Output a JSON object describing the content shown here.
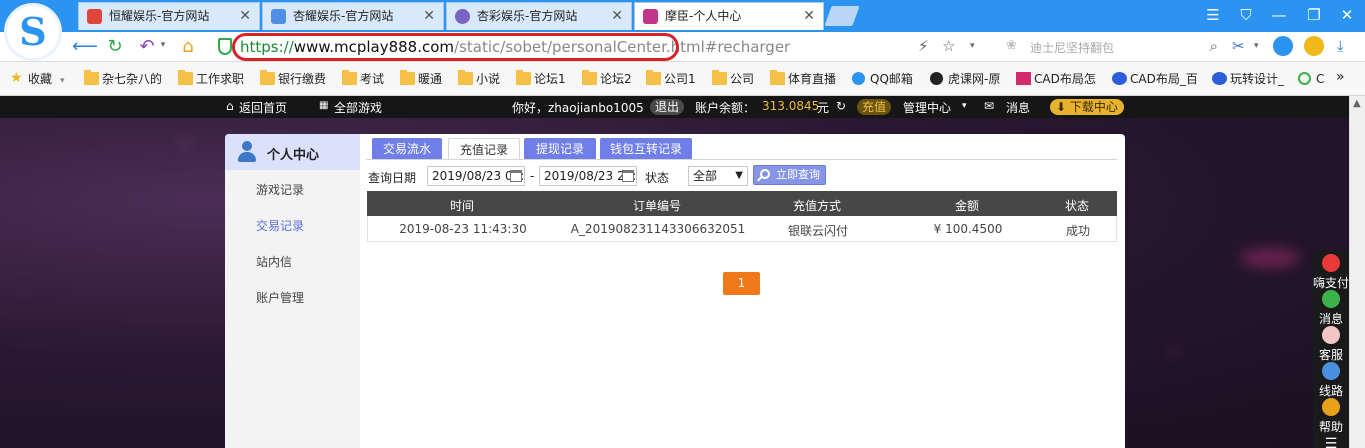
{
  "browser": {
    "tabs": [
      {
        "title": "恒耀娱乐-官方网站",
        "close": "✕"
      },
      {
        "title": "杏耀娱乐-官方网站",
        "close": "✕"
      },
      {
        "title": "杏彩娱乐-官方网站",
        "close": "✕"
      },
      {
        "title": "摩臣-个人中心",
        "close": "✕"
      }
    ],
    "window_controls": [
      "☰",
      "⛉",
      "—",
      "❐",
      "✕"
    ],
    "url": {
      "protocol": "https://",
      "host": "www.mcplay888.com",
      "path": "/static/sobet/personalCenter.html#recharger"
    },
    "search_placeholder": "迪士尼坚持翻包",
    "bookmarks": [
      "收藏",
      "杂七杂八的",
      "工作求职",
      "银行缴费",
      "考试",
      "暖通",
      "小说",
      "论坛1",
      "论坛2",
      "公司1",
      "公司",
      "体育直播",
      "QQ邮箱",
      "虎课网-原",
      "CAD布局怎",
      "CAD布局_百",
      "玩转设计_",
      "C"
    ],
    "bookmarks_more": "»"
  },
  "sitebar": {
    "back_home": "返回首页",
    "all_games": "全部游戏",
    "greeting": "你好，zhaojianbo1005",
    "logout": "退出",
    "balance_label": "账户余额：",
    "balance_value": "313.0845",
    "balance_unit": "元",
    "recharge": "充值",
    "manage": "管理中心",
    "messages": "消息",
    "download": "下载中心"
  },
  "sidebar": {
    "title": "个人中心",
    "items": [
      "游戏记录",
      "交易记录",
      "站内信",
      "账户管理"
    ]
  },
  "content": {
    "tabs": [
      "交易流水",
      "充值记录",
      "提现记录",
      "钱包互转记录"
    ],
    "query": {
      "date_label": "查询日期",
      "date_from": "2019/08/23 00:00",
      "date_sep": "-",
      "date_to": "2019/08/23 23:59",
      "status_label": "状态",
      "status_value": "全部",
      "button": "立即查询"
    },
    "table": {
      "headers": [
        "时间",
        "订单编号",
        "充值方式",
        "金额",
        "状态"
      ],
      "rows": [
        [
          "2019-08-23 11:43:30",
          "A_201908231143306632051",
          "银联云闪付",
          "¥ 100.4500",
          "成功"
        ]
      ]
    },
    "pagination": {
      "current": "1"
    }
  },
  "float_menu": [
    "嗨支付",
    "消息",
    "客服",
    "线路",
    "帮助"
  ],
  "colors": {
    "browser_blue": "#2b93f0",
    "tab_purple": "#6f7ee8",
    "highlight_red": "#d8232a",
    "page_orange": "#f07a1a",
    "balance_gold": "#f0b93a"
  }
}
